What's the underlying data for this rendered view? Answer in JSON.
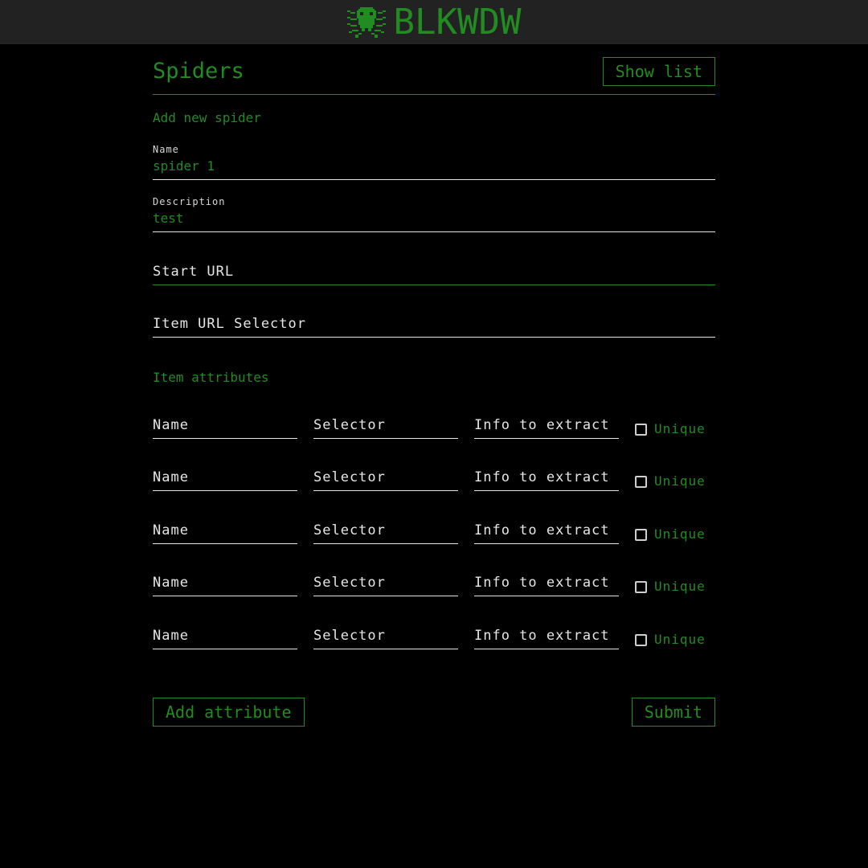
{
  "brand": {
    "name": "BLKWDW",
    "logo_icon": "spider-icon",
    "color": "#228b22"
  },
  "header": {
    "title": "Spiders",
    "show_list_label": "Show list"
  },
  "form": {
    "section_title": "Add new spider",
    "name": {
      "label": "Name",
      "value": "spider 1"
    },
    "description": {
      "label": "Description",
      "value": "test"
    },
    "start_url": {
      "placeholder": "Start URL"
    },
    "item_url_selector": {
      "placeholder": "Item URL Selector"
    },
    "attributes_title": "Item attributes",
    "attributes": [
      {
        "name_placeholder": "Name",
        "selector_placeholder": "Selector",
        "info_placeholder": "Info to extract",
        "unique_label": "Unique",
        "unique_checked": false
      },
      {
        "name_placeholder": "Name",
        "selector_placeholder": "Selector",
        "info_placeholder": "Info to extract",
        "unique_label": "Unique",
        "unique_checked": false
      },
      {
        "name_placeholder": "Name",
        "selector_placeholder": "Selector",
        "info_placeholder": "Info to extract",
        "unique_label": "Unique",
        "unique_checked": false
      },
      {
        "name_placeholder": "Name",
        "selector_placeholder": "Selector",
        "info_placeholder": "Info to extract",
        "unique_label": "Unique",
        "unique_checked": false
      },
      {
        "name_placeholder": "Name",
        "selector_placeholder": "Selector",
        "info_placeholder": "Info to extract",
        "unique_label": "Unique",
        "unique_checked": false
      }
    ],
    "add_attribute_label": "Add attribute",
    "submit_label": "Submit"
  },
  "colors": {
    "background": "#000000",
    "topbar": "#222222",
    "accent": "#228b22",
    "text": "#e6e6e6"
  }
}
